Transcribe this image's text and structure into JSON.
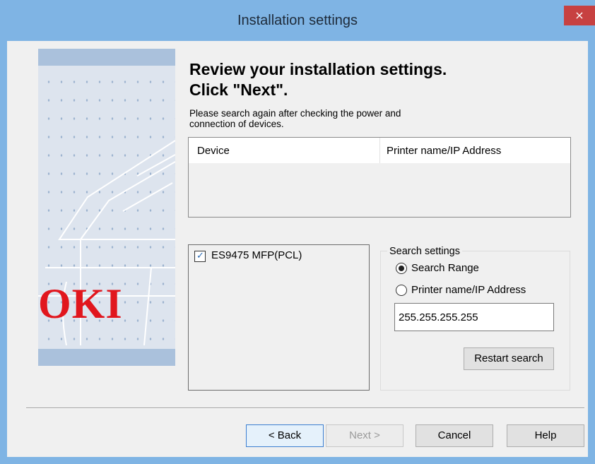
{
  "window": {
    "title": "Installation settings",
    "close_glyph": "×"
  },
  "banner": {
    "logo_text": "OKI",
    "logo_color": "#e1161d"
  },
  "header": {
    "line1": "Review your installation settings.",
    "line2": "Click \"Next\"."
  },
  "note": {
    "line1": "Please search again after checking the power and",
    "line2": "connection of devices."
  },
  "device_table": {
    "columns": [
      "Device",
      "Printer name/IP Address"
    ],
    "rows": []
  },
  "model_list": {
    "items": [
      {
        "label": "ES9475 MFP(PCL)",
        "checked": true
      }
    ]
  },
  "search_settings": {
    "title": "Search settings",
    "options": [
      {
        "label": "Search Range",
        "selected": true
      },
      {
        "label": "Printer name/IP Address",
        "selected": false
      }
    ],
    "ip_value": "255.255.255.255",
    "restart_label": "Restart search"
  },
  "footer": {
    "back_label": "< Back",
    "next_label": "Next >",
    "cancel_label": "Cancel",
    "help_label": "Help"
  },
  "colors": {
    "titlebar": "#7fb4e4",
    "close_button": "#c74141",
    "client_bg": "#f0f0f0",
    "default_button_border": "#3c7fd1"
  }
}
